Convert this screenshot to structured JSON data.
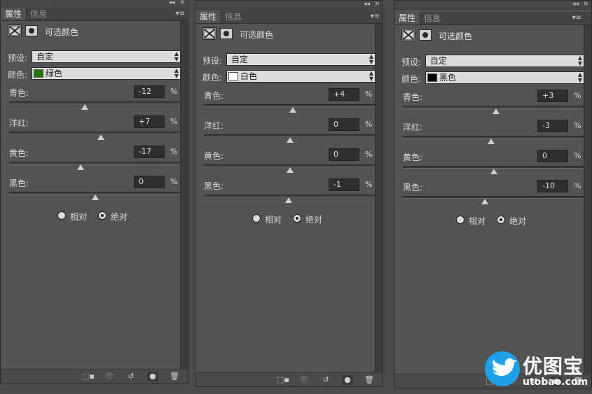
{
  "panels": [
    {
      "tabs": [
        "属性",
        "信息"
      ],
      "title": "可选颜色",
      "preset_label": "预设:",
      "preset_value": "自定",
      "color_label": "颜色:",
      "color_value": "绿色",
      "swatch": "#1f7a0c",
      "sliders": [
        {
          "label": "青色:",
          "value": "-12",
          "num": -12
        },
        {
          "label": "洋红:",
          "value": "+7",
          "num": 7
        },
        {
          "label": "黄色:",
          "value": "-17",
          "num": -17
        },
        {
          "label": "黑色:",
          "value": "0",
          "num": 0
        }
      ],
      "radio_relative": "相对",
      "radio_absolute": "绝对",
      "selected": "absolute",
      "pct": "%"
    },
    {
      "tabs": [
        "属性",
        "信息"
      ],
      "title": "可选颜色",
      "preset_label": "预设:",
      "preset_value": "自定",
      "color_label": "颜色:",
      "color_value": "白色",
      "swatch": "#ffffff",
      "sliders": [
        {
          "label": "青色:",
          "value": "+4",
          "num": 4
        },
        {
          "label": "洋红:",
          "value": "0",
          "num": 0
        },
        {
          "label": "黄色:",
          "value": "0",
          "num": 0
        },
        {
          "label": "黑色:",
          "value": "-1",
          "num": -1
        }
      ],
      "radio_relative": "相对",
      "radio_absolute": "绝对",
      "selected": "absolute",
      "pct": "%"
    },
    {
      "tabs": [
        "属性",
        "信息"
      ],
      "title": "可选颜色",
      "preset_label": "预设:",
      "preset_value": "自定",
      "color_label": "颜色:",
      "color_value": "黑色",
      "swatch": "#000000",
      "sliders": [
        {
          "label": "青色:",
          "value": "+3",
          "num": 3
        },
        {
          "label": "洋红:",
          "value": "-3",
          "num": -3
        },
        {
          "label": "黄色:",
          "value": "0",
          "num": 0
        },
        {
          "label": "黑色:",
          "value": "-10",
          "num": -10
        }
      ],
      "radio_relative": "相对",
      "radio_absolute": "绝对",
      "selected": "absolute",
      "pct": "%"
    }
  ],
  "watermark": {
    "brand": "优图宝",
    "url": "utobao.com",
    "logo_icon": "bird-icon",
    "accent": "#1ea0e8"
  }
}
